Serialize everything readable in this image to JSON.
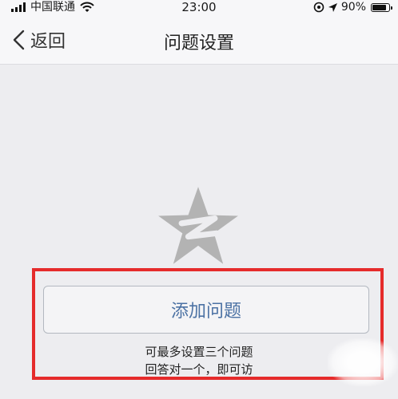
{
  "status_bar": {
    "carrier": "中国联通",
    "time": "23:00",
    "battery": "90%",
    "battery_level": 0.9
  },
  "nav": {
    "back_label": "返回",
    "title": "问题设置"
  },
  "main": {
    "add_button_label": "添加问题",
    "hint_line_1": "可最多设置三个问题",
    "hint_line_2": "回答对一个，即可访"
  },
  "colors": {
    "highlight": "#e52b2b",
    "button_text": "#4c72a4",
    "logo": "#b3b3b3"
  },
  "icons": [
    "signal-icon",
    "wifi-icon",
    "location-lock-icon",
    "location-arrow-icon",
    "battery-icon",
    "back-chevron-icon",
    "qzone-star-logo"
  ]
}
